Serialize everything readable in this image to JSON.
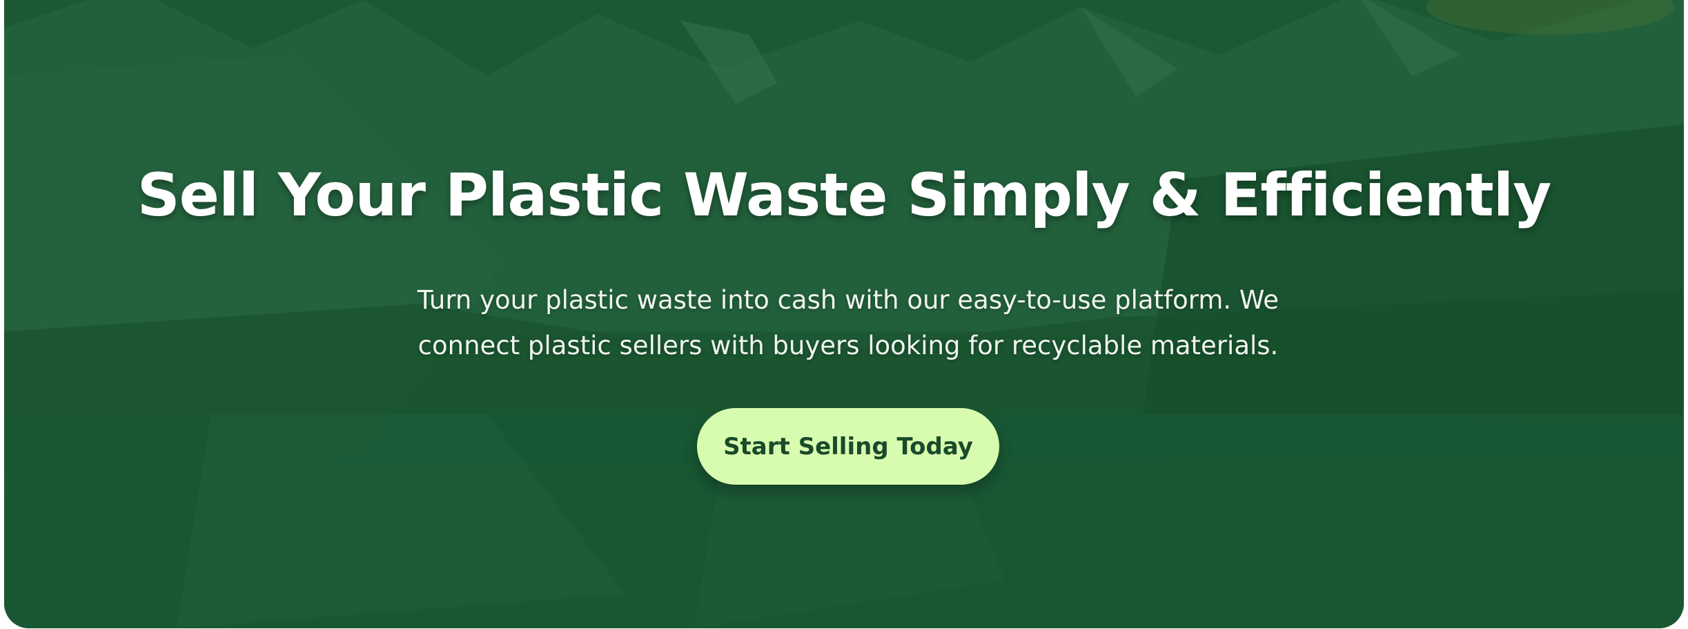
{
  "hero": {
    "title": "Sell Your Plastic Waste Simply & Efficiently",
    "subtitle": "Turn your plastic waste into cash with our easy-to-use platform. We connect plastic sellers with buyers looking for recyclable materials.",
    "cta_label": "Start Selling Today",
    "background": "mountain-lake-landscape",
    "overlay_color": "#1d5a35",
    "cta_color": "#d7fcb0",
    "cta_text_color": "#1a4a2a"
  }
}
